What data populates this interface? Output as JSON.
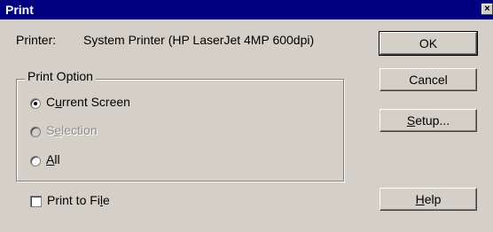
{
  "window": {
    "title": "Print",
    "close_glyph": "×"
  },
  "printer": {
    "label": "Printer:",
    "value": "System Printer (HP LaserJet 4MP 600dpi)"
  },
  "print_option": {
    "legend": "Print Option",
    "options": [
      {
        "pre": "C",
        "ul": "u",
        "post": "rrent Screen",
        "selected": true,
        "enabled": true
      },
      {
        "pre": "S",
        "ul": "e",
        "post": "lection",
        "selected": false,
        "enabled": false
      },
      {
        "pre": "",
        "ul": "A",
        "post": "ll",
        "selected": false,
        "enabled": true
      }
    ]
  },
  "print_to_file": {
    "pre": "Print to Fi",
    "ul": "l",
    "post": "e",
    "checked": false
  },
  "buttons": {
    "ok": "OK",
    "cancel": "Cancel",
    "setup": {
      "ul": "S",
      "post": "etup..."
    },
    "help": {
      "ul": "H",
      "post": "elp"
    }
  },
  "icons": {
    "close": "close-icon",
    "radio": "radio-icon",
    "checkbox": "checkbox-icon"
  }
}
